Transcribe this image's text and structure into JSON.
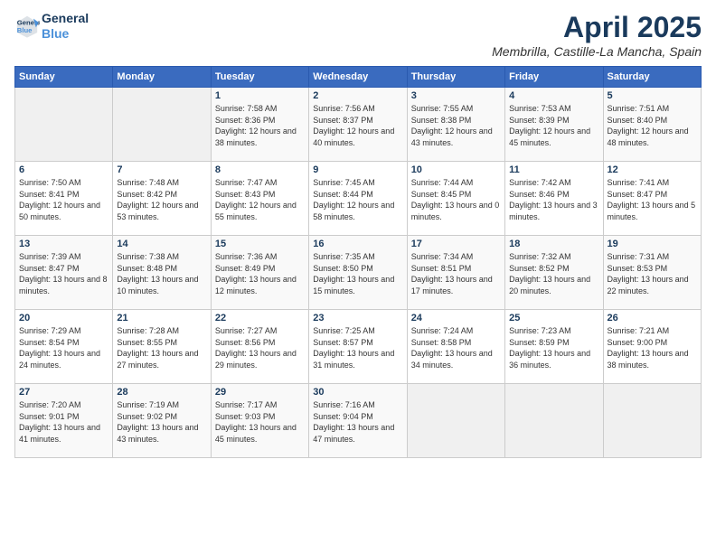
{
  "logo": {
    "line1": "General",
    "line2": "Blue"
  },
  "title": "April 2025",
  "subtitle": "Membrilla, Castille-La Mancha, Spain",
  "weekdays": [
    "Sunday",
    "Monday",
    "Tuesday",
    "Wednesday",
    "Thursday",
    "Friday",
    "Saturday"
  ],
  "weeks": [
    [
      {
        "day": "",
        "sunrise": "",
        "sunset": "",
        "daylight": ""
      },
      {
        "day": "",
        "sunrise": "",
        "sunset": "",
        "daylight": ""
      },
      {
        "day": "1",
        "sunrise": "Sunrise: 7:58 AM",
        "sunset": "Sunset: 8:36 PM",
        "daylight": "Daylight: 12 hours and 38 minutes."
      },
      {
        "day": "2",
        "sunrise": "Sunrise: 7:56 AM",
        "sunset": "Sunset: 8:37 PM",
        "daylight": "Daylight: 12 hours and 40 minutes."
      },
      {
        "day": "3",
        "sunrise": "Sunrise: 7:55 AM",
        "sunset": "Sunset: 8:38 PM",
        "daylight": "Daylight: 12 hours and 43 minutes."
      },
      {
        "day": "4",
        "sunrise": "Sunrise: 7:53 AM",
        "sunset": "Sunset: 8:39 PM",
        "daylight": "Daylight: 12 hours and 45 minutes."
      },
      {
        "day": "5",
        "sunrise": "Sunrise: 7:51 AM",
        "sunset": "Sunset: 8:40 PM",
        "daylight": "Daylight: 12 hours and 48 minutes."
      }
    ],
    [
      {
        "day": "6",
        "sunrise": "Sunrise: 7:50 AM",
        "sunset": "Sunset: 8:41 PM",
        "daylight": "Daylight: 12 hours and 50 minutes."
      },
      {
        "day": "7",
        "sunrise": "Sunrise: 7:48 AM",
        "sunset": "Sunset: 8:42 PM",
        "daylight": "Daylight: 12 hours and 53 minutes."
      },
      {
        "day": "8",
        "sunrise": "Sunrise: 7:47 AM",
        "sunset": "Sunset: 8:43 PM",
        "daylight": "Daylight: 12 hours and 55 minutes."
      },
      {
        "day": "9",
        "sunrise": "Sunrise: 7:45 AM",
        "sunset": "Sunset: 8:44 PM",
        "daylight": "Daylight: 12 hours and 58 minutes."
      },
      {
        "day": "10",
        "sunrise": "Sunrise: 7:44 AM",
        "sunset": "Sunset: 8:45 PM",
        "daylight": "Daylight: 13 hours and 0 minutes."
      },
      {
        "day": "11",
        "sunrise": "Sunrise: 7:42 AM",
        "sunset": "Sunset: 8:46 PM",
        "daylight": "Daylight: 13 hours and 3 minutes."
      },
      {
        "day": "12",
        "sunrise": "Sunrise: 7:41 AM",
        "sunset": "Sunset: 8:47 PM",
        "daylight": "Daylight: 13 hours and 5 minutes."
      }
    ],
    [
      {
        "day": "13",
        "sunrise": "Sunrise: 7:39 AM",
        "sunset": "Sunset: 8:47 PM",
        "daylight": "Daylight: 13 hours and 8 minutes."
      },
      {
        "day": "14",
        "sunrise": "Sunrise: 7:38 AM",
        "sunset": "Sunset: 8:48 PM",
        "daylight": "Daylight: 13 hours and 10 minutes."
      },
      {
        "day": "15",
        "sunrise": "Sunrise: 7:36 AM",
        "sunset": "Sunset: 8:49 PM",
        "daylight": "Daylight: 13 hours and 12 minutes."
      },
      {
        "day": "16",
        "sunrise": "Sunrise: 7:35 AM",
        "sunset": "Sunset: 8:50 PM",
        "daylight": "Daylight: 13 hours and 15 minutes."
      },
      {
        "day": "17",
        "sunrise": "Sunrise: 7:34 AM",
        "sunset": "Sunset: 8:51 PM",
        "daylight": "Daylight: 13 hours and 17 minutes."
      },
      {
        "day": "18",
        "sunrise": "Sunrise: 7:32 AM",
        "sunset": "Sunset: 8:52 PM",
        "daylight": "Daylight: 13 hours and 20 minutes."
      },
      {
        "day": "19",
        "sunrise": "Sunrise: 7:31 AM",
        "sunset": "Sunset: 8:53 PM",
        "daylight": "Daylight: 13 hours and 22 minutes."
      }
    ],
    [
      {
        "day": "20",
        "sunrise": "Sunrise: 7:29 AM",
        "sunset": "Sunset: 8:54 PM",
        "daylight": "Daylight: 13 hours and 24 minutes."
      },
      {
        "day": "21",
        "sunrise": "Sunrise: 7:28 AM",
        "sunset": "Sunset: 8:55 PM",
        "daylight": "Daylight: 13 hours and 27 minutes."
      },
      {
        "day": "22",
        "sunrise": "Sunrise: 7:27 AM",
        "sunset": "Sunset: 8:56 PM",
        "daylight": "Daylight: 13 hours and 29 minutes."
      },
      {
        "day": "23",
        "sunrise": "Sunrise: 7:25 AM",
        "sunset": "Sunset: 8:57 PM",
        "daylight": "Daylight: 13 hours and 31 minutes."
      },
      {
        "day": "24",
        "sunrise": "Sunrise: 7:24 AM",
        "sunset": "Sunset: 8:58 PM",
        "daylight": "Daylight: 13 hours and 34 minutes."
      },
      {
        "day": "25",
        "sunrise": "Sunrise: 7:23 AM",
        "sunset": "Sunset: 8:59 PM",
        "daylight": "Daylight: 13 hours and 36 minutes."
      },
      {
        "day": "26",
        "sunrise": "Sunrise: 7:21 AM",
        "sunset": "Sunset: 9:00 PM",
        "daylight": "Daylight: 13 hours and 38 minutes."
      }
    ],
    [
      {
        "day": "27",
        "sunrise": "Sunrise: 7:20 AM",
        "sunset": "Sunset: 9:01 PM",
        "daylight": "Daylight: 13 hours and 41 minutes."
      },
      {
        "day": "28",
        "sunrise": "Sunrise: 7:19 AM",
        "sunset": "Sunset: 9:02 PM",
        "daylight": "Daylight: 13 hours and 43 minutes."
      },
      {
        "day": "29",
        "sunrise": "Sunrise: 7:17 AM",
        "sunset": "Sunset: 9:03 PM",
        "daylight": "Daylight: 13 hours and 45 minutes."
      },
      {
        "day": "30",
        "sunrise": "Sunrise: 7:16 AM",
        "sunset": "Sunset: 9:04 PM",
        "daylight": "Daylight: 13 hours and 47 minutes."
      },
      {
        "day": "",
        "sunrise": "",
        "sunset": "",
        "daylight": ""
      },
      {
        "day": "",
        "sunrise": "",
        "sunset": "",
        "daylight": ""
      },
      {
        "day": "",
        "sunrise": "",
        "sunset": "",
        "daylight": ""
      }
    ]
  ]
}
